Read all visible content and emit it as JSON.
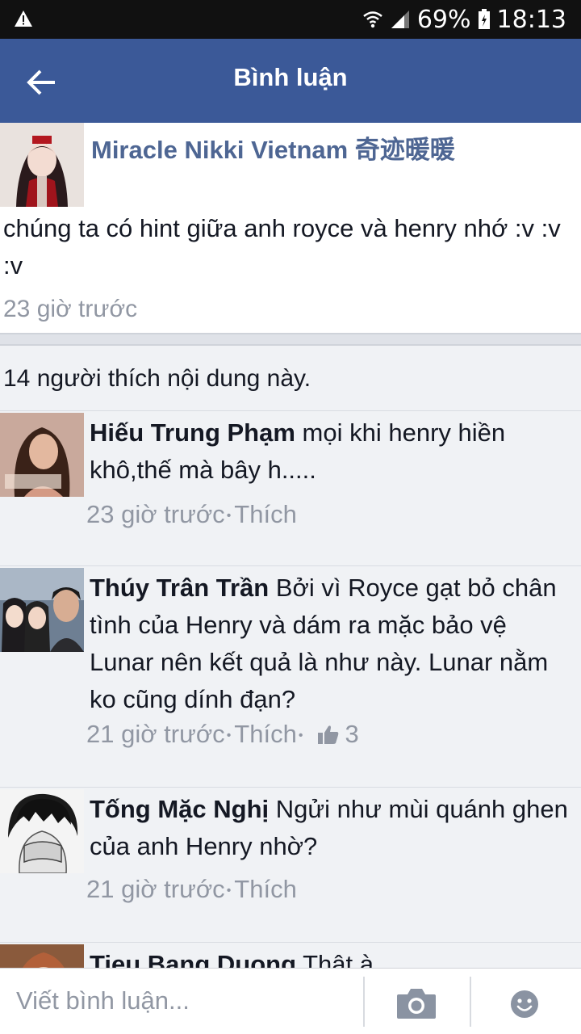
{
  "status_bar": {
    "battery": "69%",
    "time": "18:13"
  },
  "header": {
    "title": "Bình luận"
  },
  "post": {
    "author": "Miracle Nikki Vietnam 奇迹暖暖",
    "text": "chúng ta có hint giữa anh royce và henry nhớ :v :v :v",
    "time": "23 giờ trước"
  },
  "likes_summary": "14 người thích nội dung này.",
  "comments": [
    {
      "name": "Hiếu Trung Phạm",
      "text": "mọi khi henry hiền khô,thế mà bây h.....",
      "time": "23 giờ trước",
      "like_label": "Thích"
    },
    {
      "name": "Thúy Trân Trần",
      "text": "Bởi vì Royce gạt bỏ chân tình của Henry và dám ra mặc bảo vệ Lunar nên kết quả là như này. Lunar nằm ko cũng dính đạn?",
      "time": "21 giờ trước",
      "like_label": "Thích",
      "like_count": "3"
    },
    {
      "name": "Tống Mặc Nghị",
      "text": "Ngửi như mùi quánh ghen của anh Henry nhờ?",
      "time": "21 giờ trước",
      "like_label": "Thích"
    },
    {
      "name": "Tieu Bang Duong",
      "text": "Thật à"
    }
  ],
  "composer": {
    "placeholder": "Viết bình luận..."
  },
  "colors": {
    "header_bg": "#3b5998",
    "author_link": "#4e6693",
    "meta_gray": "#9197a3",
    "comments_bg": "#f0f2f5"
  }
}
